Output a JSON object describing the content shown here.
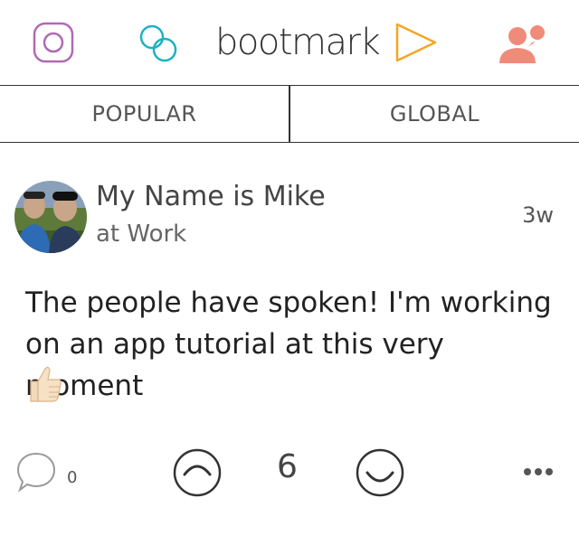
{
  "header": {
    "brand": "bootmark",
    "icons": [
      "instagram-icon",
      "links-icon",
      "play-icon",
      "people-icon"
    ],
    "colors": {
      "instagram": "#b06ab3",
      "links": "#1bb3c0",
      "play": "#f5a623",
      "people": "#f08b7a"
    }
  },
  "tabs": [
    {
      "label": "POPULAR"
    },
    {
      "label": "GLOBAL"
    }
  ],
  "post": {
    "author": "My Name is Mike",
    "subtitle": "at Work",
    "time": "3w",
    "text": "The people have spoken! I'm working on an app tutorial at this very moment",
    "emoji": "thumbs-up-icon"
  },
  "actions": {
    "comment_count": "0",
    "score": "6"
  }
}
